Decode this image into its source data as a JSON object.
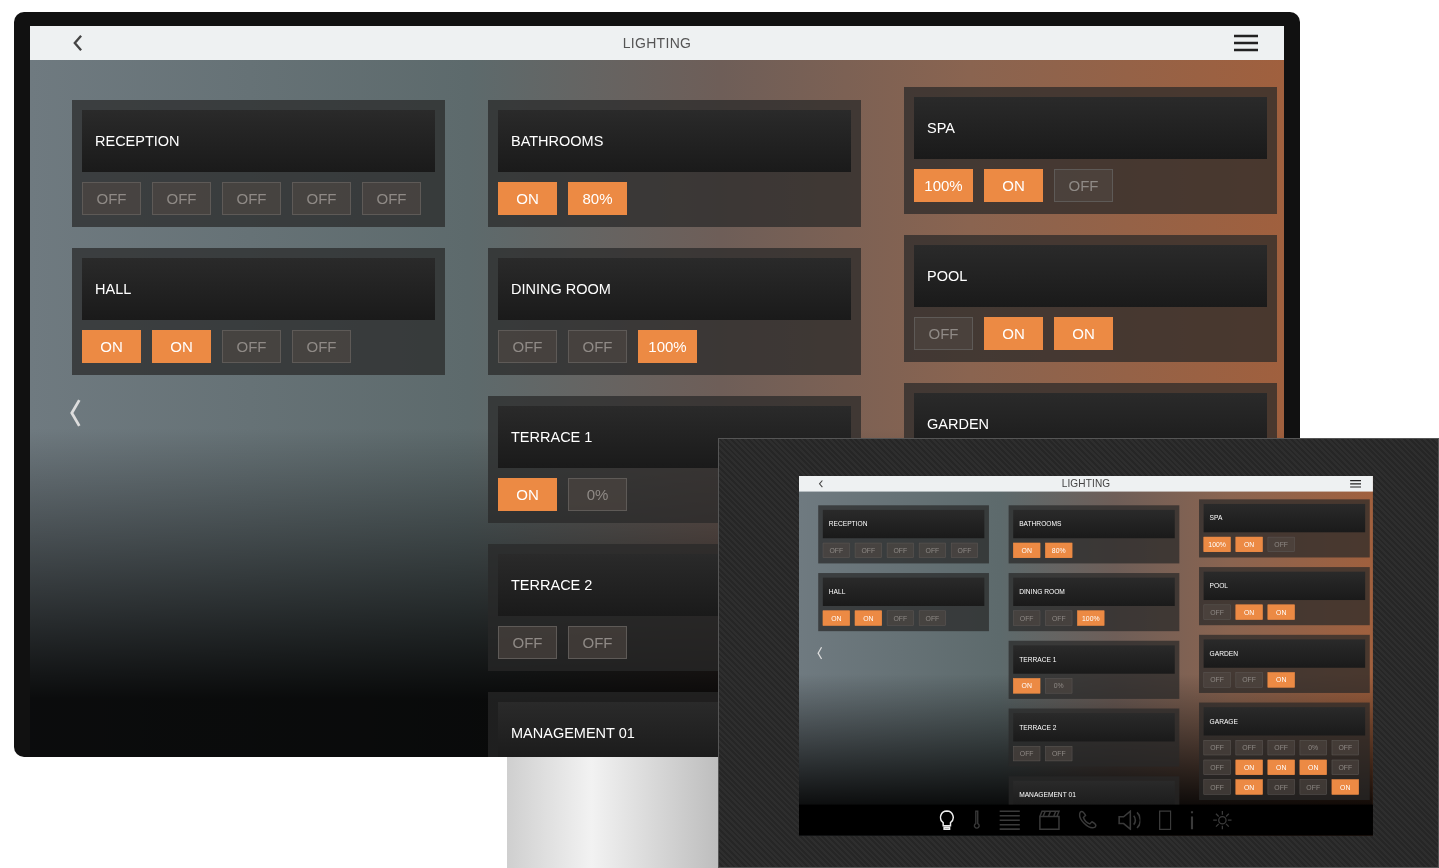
{
  "monitor": {
    "title": "LIGHTING",
    "columns": [
      {
        "rooms": [
          {
            "name": "RECEPTION",
            "buttons": [
              {
                "label": "OFF",
                "on": false
              },
              {
                "label": "OFF",
                "on": false
              },
              {
                "label": "OFF",
                "on": false
              },
              {
                "label": "OFF",
                "on": false
              },
              {
                "label": "OFF",
                "on": false
              }
            ]
          },
          {
            "name": "HALL",
            "buttons": [
              {
                "label": "ON",
                "on": true
              },
              {
                "label": "ON",
                "on": true
              },
              {
                "label": "OFF",
                "on": false
              },
              {
                "label": "OFF",
                "on": false
              }
            ]
          }
        ]
      },
      {
        "rooms": [
          {
            "name": "BATHROOMS",
            "buttons": [
              {
                "label": "ON",
                "on": true
              },
              {
                "label": "80%",
                "on": true
              }
            ]
          },
          {
            "name": "DINING ROOM",
            "buttons": [
              {
                "label": "OFF",
                "on": false
              },
              {
                "label": "OFF",
                "on": false
              },
              {
                "label": "100%",
                "on": true
              }
            ]
          },
          {
            "name": "TERRACE 1",
            "buttons": [
              {
                "label": "ON",
                "on": true
              },
              {
                "label": "0%",
                "on": false
              }
            ]
          },
          {
            "name": "TERRACE 2",
            "buttons": [
              {
                "label": "OFF",
                "on": false
              },
              {
                "label": "OFF",
                "on": false
              }
            ]
          },
          {
            "name": "MANAGEMENT 01"
          }
        ]
      },
      {
        "rooms": [
          {
            "name": "SPA",
            "buttons": [
              {
                "label": "100%",
                "on": true
              },
              {
                "label": "ON",
                "on": true
              },
              {
                "label": "OFF",
                "on": false
              }
            ]
          },
          {
            "name": "POOL",
            "buttons": [
              {
                "label": "OFF",
                "on": false
              },
              {
                "label": "ON",
                "on": true
              },
              {
                "label": "ON",
                "on": true
              }
            ]
          },
          {
            "name": "GARDEN"
          }
        ]
      }
    ]
  },
  "tablet": {
    "title": "LIGHTING",
    "columns": [
      {
        "rooms": [
          {
            "name": "RECEPTION",
            "buttons": [
              {
                "label": "OFF",
                "on": false
              },
              {
                "label": "OFF",
                "on": false
              },
              {
                "label": "OFF",
                "on": false
              },
              {
                "label": "OFF",
                "on": false
              },
              {
                "label": "OFF",
                "on": false
              }
            ]
          },
          {
            "name": "HALL",
            "buttons": [
              {
                "label": "ON",
                "on": true
              },
              {
                "label": "ON",
                "on": true
              },
              {
                "label": "OFF",
                "on": false
              },
              {
                "label": "OFF",
                "on": false
              }
            ]
          }
        ]
      },
      {
        "rooms": [
          {
            "name": "BATHROOMS",
            "buttons": [
              {
                "label": "ON",
                "on": true
              },
              {
                "label": "80%",
                "on": true
              }
            ]
          },
          {
            "name": "DINING ROOM",
            "buttons": [
              {
                "label": "OFF",
                "on": false
              },
              {
                "label": "OFF",
                "on": false
              },
              {
                "label": "100%",
                "on": true
              }
            ]
          },
          {
            "name": "TERRACE 1",
            "buttons": [
              {
                "label": "ON",
                "on": true
              },
              {
                "label": "0%",
                "on": false
              }
            ]
          },
          {
            "name": "TERRACE 2",
            "buttons": [
              {
                "label": "OFF",
                "on": false
              },
              {
                "label": "OFF",
                "on": false
              }
            ]
          },
          {
            "name": "MANAGEMENT 01"
          }
        ]
      },
      {
        "rooms": [
          {
            "name": "SPA",
            "buttons": [
              {
                "label": "100%",
                "on": true
              },
              {
                "label": "ON",
                "on": true
              },
              {
                "label": "OFF",
                "on": false
              }
            ]
          },
          {
            "name": "POOL",
            "buttons": [
              {
                "label": "OFF",
                "on": false
              },
              {
                "label": "ON",
                "on": true
              },
              {
                "label": "ON",
                "on": true
              }
            ]
          },
          {
            "name": "GARDEN",
            "buttons": [
              {
                "label": "OFF",
                "on": false
              },
              {
                "label": "OFF",
                "on": false
              },
              {
                "label": "ON",
                "on": true
              }
            ]
          },
          {
            "name": "GARAGE",
            "buttons": [
              {
                "label": "OFF",
                "on": false
              },
              {
                "label": "OFF",
                "on": false
              },
              {
                "label": "OFF",
                "on": false
              },
              {
                "label": "0%",
                "on": false
              },
              {
                "label": "OFF",
                "on": false
              },
              {
                "label": "OFF",
                "on": false
              },
              {
                "label": "ON",
                "on": true
              },
              {
                "label": "ON",
                "on": true
              },
              {
                "label": "ON",
                "on": true
              },
              {
                "label": "OFF",
                "on": false
              },
              {
                "label": "OFF",
                "on": false
              },
              {
                "label": "ON",
                "on": true
              },
              {
                "label": "OFF",
                "on": false
              },
              {
                "label": "OFF",
                "on": false
              },
              {
                "label": "ON",
                "on": true
              }
            ]
          }
        ]
      }
    ],
    "nav": [
      {
        "kind": "bulb",
        "selected": true
      },
      {
        "kind": "thermometer",
        "selected": false
      },
      {
        "kind": "blinds",
        "selected": false
      },
      {
        "kind": "clapper",
        "selected": false
      },
      {
        "kind": "phone",
        "selected": false
      },
      {
        "kind": "speaker",
        "selected": false
      },
      {
        "kind": "tablet",
        "selected": false
      },
      {
        "kind": "info",
        "selected": false
      },
      {
        "kind": "gear",
        "selected": false
      }
    ]
  }
}
